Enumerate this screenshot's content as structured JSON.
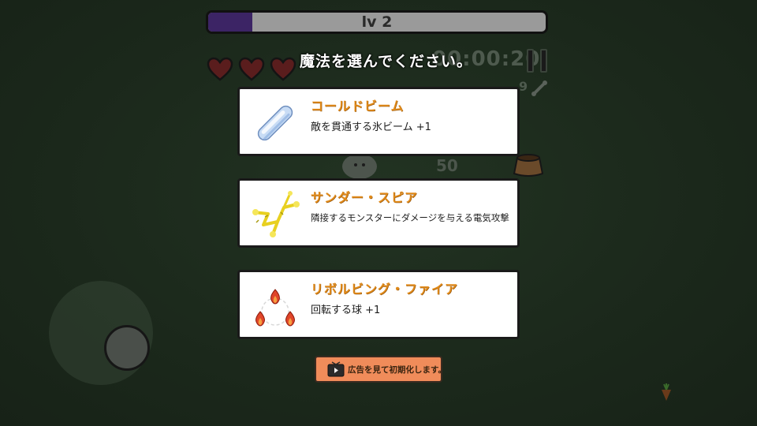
{
  "hud": {
    "level_label": "lv 2",
    "level_progress": 0.13,
    "hearts": 3,
    "timer": "00:00:20",
    "kill_count": "9",
    "coin_count": "50"
  },
  "overlay": {
    "title": "魔法を選んでください。"
  },
  "cards": [
    {
      "name": "コールドビーム",
      "description": "敵を貫通する氷ビーム +1",
      "icon": "ice-beam-icon"
    },
    {
      "name": "サンダー・スピア",
      "description": "隣接するモンスターにダメージを与える電気攻撃",
      "icon": "lightning-spear-icon"
    },
    {
      "name": "リボルビング・ファイア",
      "description": "回転する球 +1",
      "icon": "revolving-fire-icon"
    }
  ],
  "ad_button": {
    "label": "広告を見て初期化します。",
    "icon": "tv-play-icon"
  },
  "colors": {
    "card_title": "#e08a1a",
    "level_fill": "#3c2465",
    "ad_button": "#f08c5a",
    "heart": "#6b2222"
  }
}
